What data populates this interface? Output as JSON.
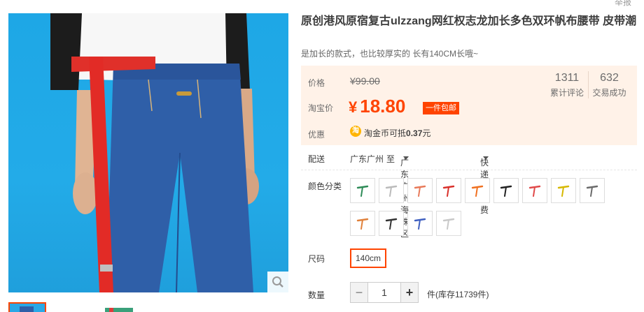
{
  "header": {
    "report_label": "举报"
  },
  "product": {
    "title": "原创港风原宿复古ulzzang网红权志龙加长多色双环帆布腰带 皮带潮",
    "subtitle": "是加长的款式，也比较厚实的 长有140CM长哦~"
  },
  "price": {
    "orig_label": "价格",
    "orig_value": "¥99.00",
    "promo_label": "淘宝价",
    "currency": "¥",
    "promo_value": "18.80",
    "badge": "一件包邮",
    "discount_label": "优惠",
    "coin_icon": "淘",
    "coin_prefix": "淘金币可抵",
    "coin_amount": "0.37",
    "coin_suffix": "元"
  },
  "stats": [
    {
      "num": "1311",
      "label": "累计评论"
    },
    {
      "num": "632",
      "label": "交易成功"
    }
  ],
  "shipping": {
    "label": "配送",
    "from": "广东广州",
    "to_word": "至",
    "to": "广东广州海珠区",
    "method": "快递 免运费"
  },
  "sku": {
    "color_label": "颜色分类",
    "colors": [
      "#2e8b57",
      "#bbbbbb",
      "#e87a5a",
      "#d9302a",
      "#f07020",
      "#222222",
      "#e04848",
      "#d6b800",
      "#6b6b6b",
      "#e0803a",
      "#333333",
      "#4060c0",
      "#c8c8c8"
    ],
    "size_label": "尺码",
    "size_value": "140cm",
    "qty_label": "数量",
    "qty_value": "1",
    "stock_text": "件(库存11739件)"
  },
  "icons": {
    "zoom": "magnifier-icon",
    "minus": "minus-icon",
    "plus": "plus-icon"
  }
}
